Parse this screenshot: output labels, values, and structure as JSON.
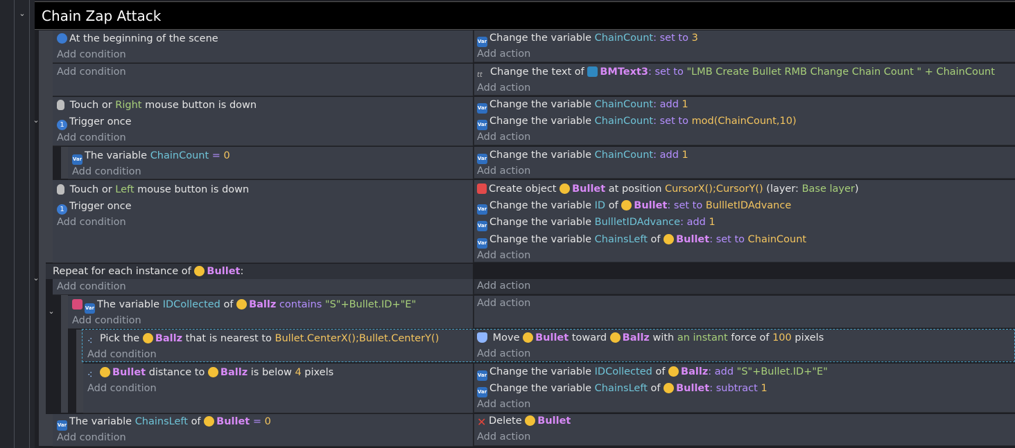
{
  "group": {
    "title": "Chain Zap Attack"
  },
  "add_condition": "Add condition",
  "add_action": "Add action",
  "events": {
    "e1": {
      "cond1": "At the beginning of the scene",
      "act1": {
        "pre": "Change the variable",
        "var": "ChainCount",
        "op": ": set to",
        "val": "3"
      }
    },
    "e2": {
      "act1": {
        "pre": "Change the text of",
        "obj": "BMText3",
        "op": ": set to",
        "val": "\"LMB Create Bullet RMB Change Chain Count \" + ChainCount"
      }
    },
    "e3": {
      "cond1": {
        "pre": "Touch or",
        "btn": "Right",
        "post": "mouse button is down"
      },
      "cond2": "Trigger once",
      "act1": {
        "pre": "Change the variable",
        "var": "ChainCount",
        "op": ": add",
        "val": "1"
      },
      "act2": {
        "pre": "Change the variable",
        "var": "ChainCount",
        "op": ": set to",
        "val": "mod(ChainCount,10)"
      }
    },
    "e3sub": {
      "cond1": {
        "pre": "The variable",
        "var": "ChainCount",
        "op": "=",
        "val": "0"
      },
      "act1": {
        "pre": "Change the variable",
        "var": "ChainCount",
        "op": ": add",
        "val": "1"
      }
    },
    "e4": {
      "cond1": {
        "pre": "Touch or",
        "btn": "Left",
        "post": "mouse button is down"
      },
      "cond2": "Trigger once",
      "act1": {
        "pre": "Create object",
        "obj": "Bullet",
        "mid": "at position",
        "pos": "CursorX();CursorY()",
        "layer_pre": "(layer:",
        "layer": "Base layer",
        "layer_post": ")"
      },
      "act2": {
        "pre": "Change the variable",
        "var": "ID",
        "of": "of",
        "obj": "Bullet",
        "op": ": set to",
        "val": "BullletIDAdvance"
      },
      "act3": {
        "pre": "Change the variable",
        "var": "BullletIDAdvance",
        "op": ": add",
        "val": "1"
      },
      "act4": {
        "pre": "Change the variable",
        "var": "ChainsLeft",
        "of": "of",
        "obj": "Bullet",
        "op": ": set to",
        "val": "ChainCount"
      }
    },
    "repeat": {
      "pre": "Repeat for each instance of",
      "obj": "Bullet",
      "post": ":"
    },
    "r1": {
      "cond1": {
        "pre": "The variable",
        "var": "IDCollected",
        "of": "of",
        "obj": "Ballz",
        "op": "contains",
        "val": "\"S\"+Bullet.ID+\"E\""
      }
    },
    "r1a": {
      "cond1": {
        "pre": "Pick the",
        "obj": "Ballz",
        "mid": "that is nearest to",
        "val": "Bullet.CenterX();Bullet.CenterY()"
      },
      "act1": {
        "pre": "Move",
        "obj": "Bullet",
        "mid": "toward",
        "obj2": "Ballz",
        "with": "with",
        "force": "an instant",
        "force_post": "force of",
        "val": "100",
        "unit": "pixels"
      }
    },
    "r1b": {
      "cond1": {
        "obj": "Bullet",
        "mid": "distance to",
        "obj2": "Ballz",
        "op": "is below",
        "val": "4",
        "unit": "pixels"
      },
      "act1": {
        "pre": "Change the variable",
        "var": "IDCollected",
        "of": "of",
        "obj": "Ballz",
        "op": ": add",
        "val": "\"S\"+Bullet.ID+\"E\""
      },
      "act2": {
        "pre": "Change the variable",
        "var": "ChainsLeft",
        "of": "of",
        "obj": "Bullet",
        "op": ": subtract",
        "val": "1"
      }
    },
    "e5": {
      "cond1": {
        "pre": "The variable",
        "var": "ChainsLeft",
        "of": "of",
        "obj": "Bullet",
        "op": "=",
        "val": "0"
      },
      "act1": {
        "pre": "Delete",
        "obj": "Bullet"
      }
    }
  },
  "icons": {
    "variable": "variable-icon",
    "scene": "scene-start-icon",
    "mouse": "mouse-icon",
    "trigger": "trigger-once-icon",
    "object": "smiley-object-icon",
    "text": "text-icon",
    "create": "create-object-icon",
    "pick": "pick-nearest-icon",
    "move": "move-toward-icon",
    "delete": "delete-icon"
  },
  "colors": {
    "variable": "#6fc4d8",
    "operator": "#b58fff",
    "number": "#f4c55f",
    "string": "#a8d07a",
    "object": "#d88af7"
  }
}
